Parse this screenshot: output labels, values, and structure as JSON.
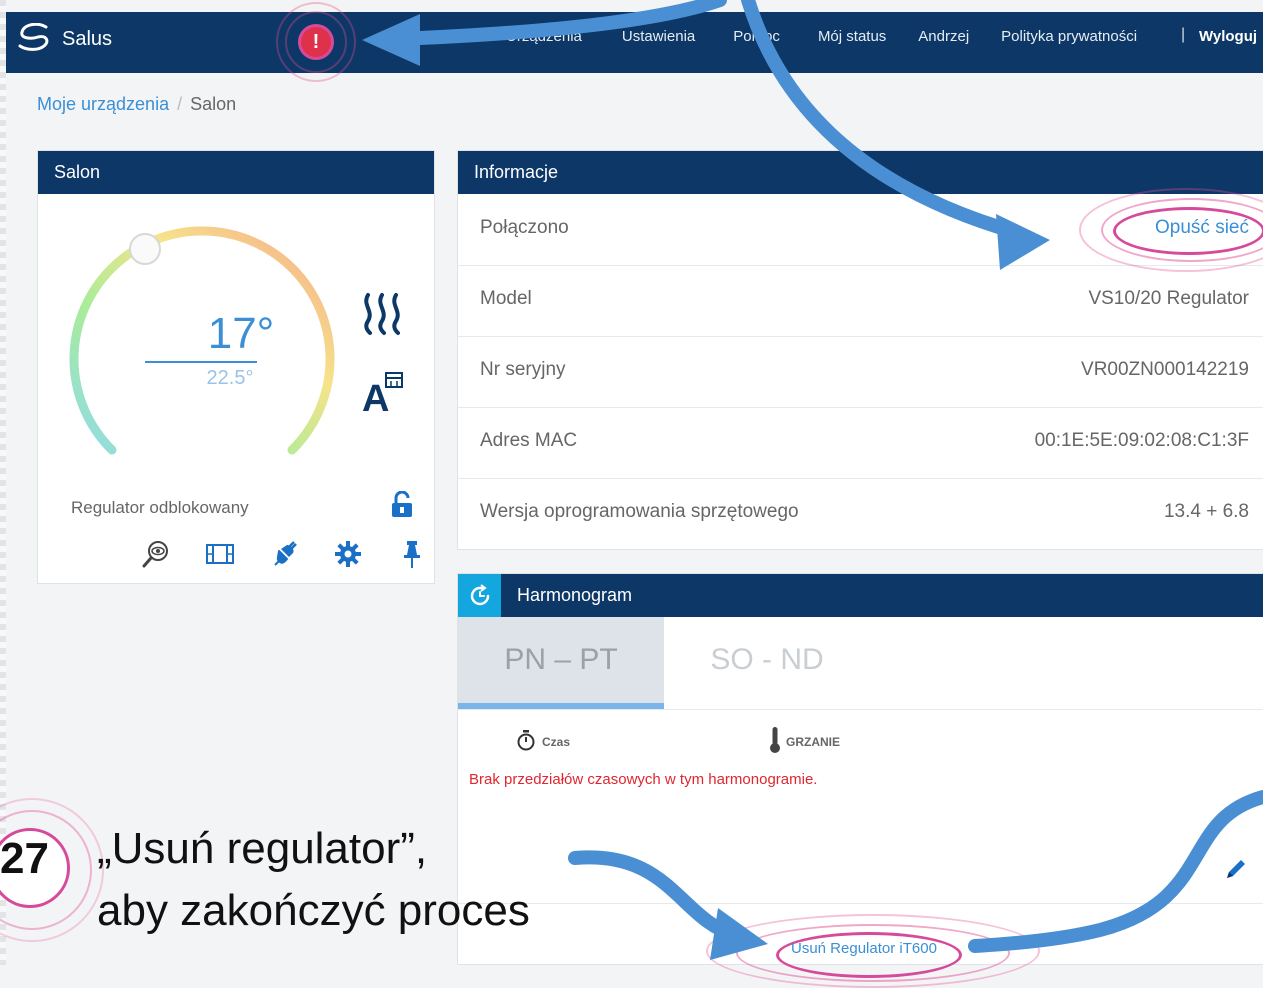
{
  "navbar": {
    "brand": "Salus",
    "menu": [
      "Urządzenia",
      "Ustawienia",
      "Pomoc",
      "Mój status",
      "Andrzej",
      "Polityka prywatności"
    ],
    "separator": "|",
    "logout": "Wyloguj",
    "alert_symbol": "!"
  },
  "breadcrumb": {
    "parent": "Moje urządzenia",
    "separator": "/",
    "current": "Salon"
  },
  "device": {
    "title": "Salon",
    "set_temp": "17°",
    "current_temp": "22.5°",
    "lock_status": "Regulator odblokowany",
    "icons": [
      "heating-icon",
      "auto-schedule-icon",
      "lock-open-icon",
      "view-icon",
      "film-icon",
      "plug-icon",
      "gear-icon",
      "pin-icon"
    ]
  },
  "info": {
    "title": "Informacje",
    "rows": [
      {
        "label": "Połączono",
        "value": "Opuść sieć"
      },
      {
        "label": "Model",
        "value": "VS10/20 Regulator"
      },
      {
        "label": "Nr seryjny",
        "value": "VR00ZN000142219"
      },
      {
        "label": "Adres MAC",
        "value": "00:1E:5E:09:02:08:C1:3F"
      },
      {
        "label": "Wersja oprogramowania sprzętowego",
        "value": "13.4 + 6.8"
      }
    ]
  },
  "schedule": {
    "title": "Harmonogram",
    "tab_weekdays": "PN – PT",
    "tab_weekend": "SO - ND",
    "col_time": "Czas",
    "col_heat": "GRZANIE",
    "empty_message": "Brak przedziałów czasowych w tym harmonogramie.",
    "remove_button": "Usuń Regulator iT600"
  },
  "tutorial": {
    "step": "27",
    "line1": "„Usuń regulator”,",
    "line2": "aby zakończyć proces",
    "accent_color": "#d64a9b",
    "arrow_color": "#4a8fd4"
  },
  "colors": {
    "navy": "#0c3766",
    "blue": "#3a8fd6",
    "red": "#e0262f",
    "cyan": "#14a6de"
  }
}
